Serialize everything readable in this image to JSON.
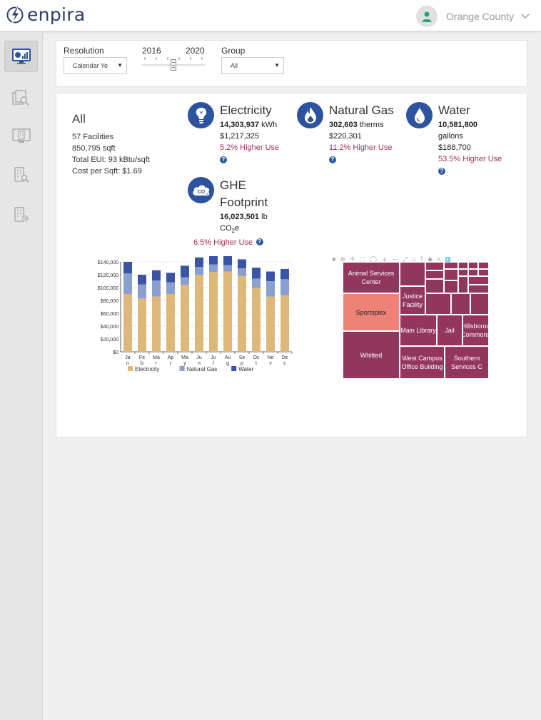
{
  "header": {
    "brand": "enpira",
    "org_name": "Orange County"
  },
  "sidebar": {
    "items": [
      {
        "name": "dashboard",
        "active": true
      },
      {
        "name": "reports",
        "active": false
      },
      {
        "name": "monitor",
        "active": false
      },
      {
        "name": "building-search",
        "active": false
      },
      {
        "name": "building-settings",
        "active": false
      }
    ]
  },
  "filters": {
    "resolution_label": "Resolution",
    "resolution_value": "Calendar Ye",
    "year_start": "2016",
    "year_end": "2020",
    "group_label": "Group",
    "group_value": "All"
  },
  "summary": {
    "title": "All",
    "facilities": "57 Facilities",
    "sqft": "850,795 sqft",
    "eui": "Total EUI: 93 kBtu/sqft",
    "cost_sqft": "Cost per Sqft: $1.69"
  },
  "metrics": {
    "electricity": {
      "title": "Electricity",
      "amount": "14,303,937",
      "unit": "kWh",
      "cost": "$1,217,325",
      "pct": "5.2% Higher Use"
    },
    "gas": {
      "title": "Natural Gas",
      "amount": "302,603",
      "unit": "therms",
      "cost": "$220,301",
      "pct": "11.2% Higher Use"
    },
    "water": {
      "title": "Water",
      "amount": "10,581,800",
      "unit": "gallons",
      "cost": "$188,700",
      "pct": "53.5% Higher Use"
    },
    "ghe": {
      "title_line1": "GHE",
      "title_line2": "Footprint",
      "amount": "16,023,501",
      "unit": "lb",
      "unit2": "CO",
      "unit2_sub": "2",
      "unit2_end": "e",
      "pct": "6.5% Higher Use"
    }
  },
  "colors": {
    "electricity": "#deb878",
    "gas": "#8a9fd0",
    "water": "#3a55a6",
    "treemap": "#93365d",
    "treemap_highlight": "#ee8277",
    "accent": "#2c52a0",
    "pct_text": "#9b2f5e"
  },
  "chart_data": {
    "type": "bar",
    "stacked": true,
    "categories": [
      "Jan",
      "Feb",
      "Mar",
      "Apr",
      "May",
      "Jun",
      "Jul",
      "Aug",
      "Sep",
      "Oct",
      "Nov",
      "Dec"
    ],
    "series": [
      {
        "name": "Electricity",
        "values": [
          90000,
          83000,
          86000,
          90000,
          104000,
          120000,
          124000,
          125000,
          118000,
          100000,
          86000,
          88000
        ]
      },
      {
        "name": "Natural Gas",
        "values": [
          32000,
          22000,
          25000,
          18000,
          12000,
          12000,
          12000,
          10000,
          12000,
          14000,
          24000,
          25000
        ]
      },
      {
        "name": "Water",
        "values": [
          18000,
          15000,
          16000,
          15000,
          18000,
          15000,
          16000,
          16000,
          14000,
          17000,
          15000,
          16000
        ]
      }
    ],
    "yticks": [
      "$0",
      "$20,000",
      "$40,000",
      "$60,000",
      "$80,000",
      "$100,000",
      "$120,000",
      "$140,000"
    ],
    "ylim": [
      0,
      140000
    ],
    "grid": true,
    "legend": "bottom"
  },
  "treemap": {
    "cells": [
      {
        "label": "Animal Services Center"
      },
      {
        "label": "Justice Facility"
      },
      {
        "label": "Sportsplex"
      },
      {
        "label": "Main Library"
      },
      {
        "label": "Jail"
      },
      {
        "label": "Hillsborou Commons"
      },
      {
        "label": "Whitted"
      },
      {
        "label": "West Campus Office Building"
      },
      {
        "label": "Southern Services C"
      }
    ]
  }
}
